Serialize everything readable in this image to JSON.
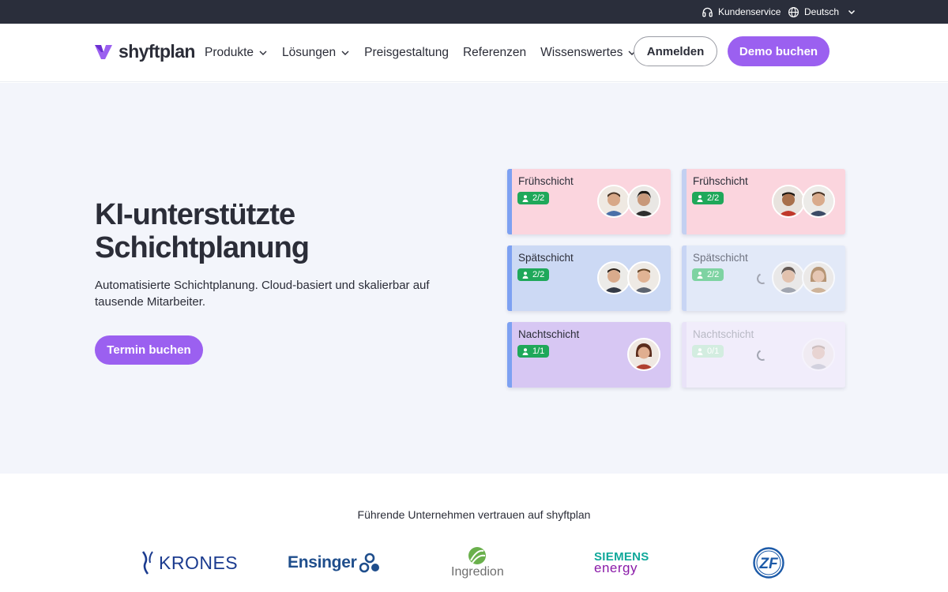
{
  "topbar": {
    "customer_service": "Kundenservice",
    "language": "Deutsch"
  },
  "nav": {
    "logo_text": "shyftplan",
    "menu": [
      {
        "label": "Produkte",
        "has_dropdown": true
      },
      {
        "label": "Lösungen",
        "has_dropdown": true
      },
      {
        "label": "Preisgestaltung",
        "has_dropdown": false
      },
      {
        "label": "Referenzen",
        "has_dropdown": false
      },
      {
        "label": "Wissenswertes",
        "has_dropdown": true
      }
    ],
    "login_label": "Anmelden",
    "demo_label": "Demo buchen"
  },
  "hero": {
    "title_line1": "KI-unterstützte",
    "title_line2": "Schichtplanung",
    "subtitle": "Automatisierte Schichtplanung. Cloud-basiert und skalierbar auf tausende Mitarbeiter.",
    "cta_label": "Termin buchen",
    "shifts": [
      {
        "name": "Frühschicht",
        "count": "2/2"
      },
      {
        "name": "Frühschicht",
        "count": "2/2"
      },
      {
        "name": "Spätschicht",
        "count": "2/2"
      },
      {
        "name": "Spätschicht",
        "count": "2/2"
      },
      {
        "name": "Nachtschicht",
        "count": "1/1"
      },
      {
        "name": "Nachtschicht",
        "count": "0/1"
      }
    ]
  },
  "trust": {
    "headline": "Führende Unternehmen vertrauen auf shyftplan",
    "logos": [
      {
        "name": "KRONES"
      },
      {
        "name": "Ensinger"
      },
      {
        "name": "Ingredion"
      },
      {
        "name_line1": "SIEMENS",
        "name_line2": "energy"
      },
      {
        "name": "ZF"
      }
    ]
  },
  "colors": {
    "accent_purple": "#9b60f0",
    "topbar_bg": "#2a2e3b",
    "hero_bg": "#f3f5fb",
    "badge_green": "#1fa85a",
    "early_shift": "#fbd5de",
    "late_shift": "#ccd9f4",
    "night_shift": "#d7c7f3"
  }
}
